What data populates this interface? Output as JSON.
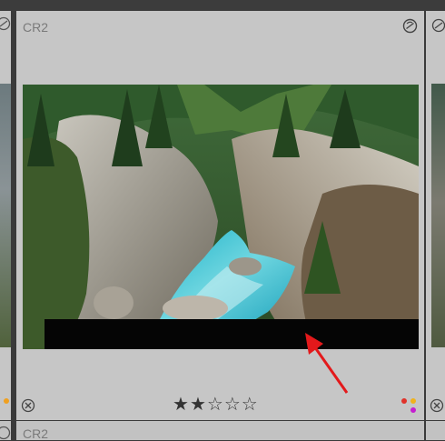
{
  "cell": {
    "file_format": "CR2"
  },
  "next_row_cell": {
    "file_format": "CR2"
  },
  "rating": {
    "value": 2,
    "max": 5,
    "filled_symbol": "★",
    "empty_symbol": "☆"
  },
  "color_labels": [
    "#e0322a",
    "#f0b21c",
    "#c51fd0"
  ],
  "left_color_label": "#f0a020",
  "overlay_box_color": "#050505",
  "arrow_color": "#e3191b",
  "icons": {
    "top_right": "no-rotate-icon",
    "bottom_left": "reject-flag-icon"
  }
}
